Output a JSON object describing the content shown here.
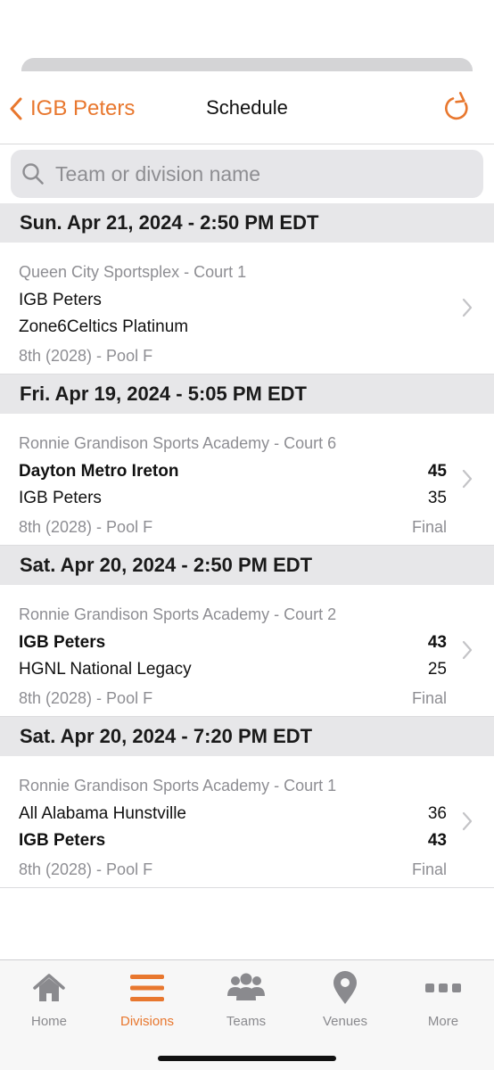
{
  "nav": {
    "back_label": "IGB Peters",
    "title": "Schedule",
    "refresh_icon": "refresh-icon"
  },
  "search": {
    "placeholder": "Team or division name",
    "value": ""
  },
  "colors": {
    "accent": "#e8772e",
    "header_bg": "#e7e7e9",
    "muted_text": "#8e8e93"
  },
  "games": [
    {
      "datetime": "Sun. Apr 21, 2024 - 2:50 PM EDT",
      "venue": "Queen City Sportsplex - Court 1",
      "team1": "IGB Peters",
      "team2": "Zone6Celtics Platinum",
      "score1": "",
      "score2": "",
      "division": "8th (2028) - Pool F",
      "status": ""
    },
    {
      "datetime": "Fri. Apr 19, 2024 - 5:05 PM EDT",
      "venue": "Ronnie Grandison Sports Academy - Court 6",
      "team1": "Dayton Metro Ireton",
      "team2": "IGB Peters",
      "score1": "45",
      "score2": "35",
      "division": "8th (2028) - Pool F",
      "status": "Final"
    },
    {
      "datetime": "Sat. Apr 20, 2024 - 2:50 PM EDT",
      "venue": "Ronnie Grandison Sports Academy - Court 2",
      "team1": "IGB Peters",
      "team2": "HGNL National Legacy",
      "score1": "43",
      "score2": "25",
      "division": "8th (2028) - Pool F",
      "status": "Final"
    },
    {
      "datetime": "Sat. Apr 20, 2024 - 7:20 PM EDT",
      "venue": "Ronnie Grandison Sports Academy - Court 1",
      "team1": "All Alabama Hunstville",
      "team2": "IGB Peters",
      "score1": "36",
      "score2": "43",
      "division": "8th (2028) - Pool F",
      "status": "Final"
    }
  ],
  "tabs": [
    {
      "label": "Home",
      "icon": "home-icon",
      "active": false
    },
    {
      "label": "Divisions",
      "icon": "list-icon",
      "active": true
    },
    {
      "label": "Teams",
      "icon": "people-icon",
      "active": false
    },
    {
      "label": "Venues",
      "icon": "location-pin-icon",
      "active": false
    },
    {
      "label": "More",
      "icon": "more-dots-icon",
      "active": false
    }
  ]
}
